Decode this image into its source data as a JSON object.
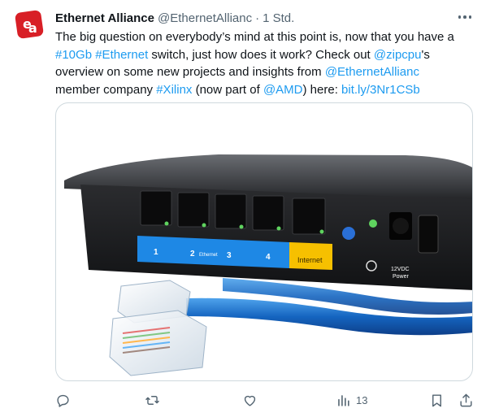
{
  "tweet": {
    "author_name": "Ethernet Alliance",
    "author_handle": "@EthernetAllianc",
    "separator": "·",
    "timestamp": "1 Std.",
    "avatar_letters": "ea",
    "text": {
      "l1": "The big question on everybody’s mind at this point is, now that you have a",
      "l2_tag1": "#10Gb",
      "l2_sp": " ",
      "l2_tag2": "#Ethernet",
      "l2_mid": " switch, just how does it work? Check out ",
      "l2_mention": "@zipcpu",
      "l2_end": "'s",
      "l3_start": "overview on some new projects and insights from ",
      "l3_mention": "@EthernetAllianc",
      "l4_start": "member company ",
      "l4_tag": "#Xilinx",
      "l4_mid": " (now part of ",
      "l4_mention": "@AMD",
      "l4_mid2": ") here: ",
      "l4_link": "bit.ly/3Nr1CSb"
    },
    "image": {
      "description_alt": "Router back panel with blue Ethernet cable",
      "port_labels": [
        "1",
        "2",
        "Ethernet",
        "3",
        "4",
        "Internet",
        "12VDC",
        "Power"
      ]
    },
    "actions": {
      "reply_icon": "reply-icon",
      "retweet_icon": "retweet-icon",
      "like_icon": "like-icon",
      "views_icon": "views-icon",
      "views_count": "13",
      "bookmark_icon": "bookmark-icon",
      "share_icon": "share-icon"
    },
    "colors": {
      "link": "#1d9bf0",
      "text": "#0f1419",
      "muted": "#536471",
      "brand_red": "#d81f26",
      "port_strip_blue": "#1e88e5",
      "internet_yellow": "#f6c000"
    }
  }
}
